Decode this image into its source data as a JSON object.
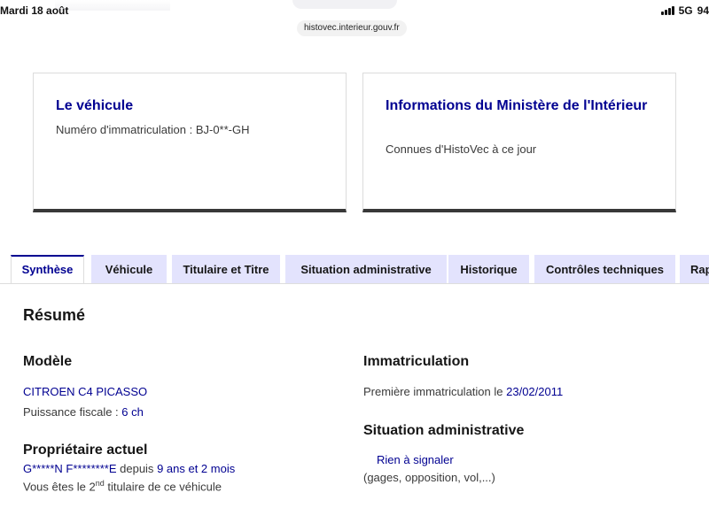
{
  "status_bar": {
    "date": "Mardi 18 août",
    "network": "5G",
    "battery": "94"
  },
  "browser": {
    "url": "histovec.interieur.gouv.fr"
  },
  "cards": {
    "vehicle": {
      "title": "Le véhicule",
      "plate_label": "Numéro d'immatriculation :",
      "plate": "BJ-0**-GH"
    },
    "ministry": {
      "title": "Informations du Ministère de l'Intérieur",
      "subtitle": "Connues d'HistoVec à ce jour"
    }
  },
  "tabs": [
    {
      "label": "Synthèse",
      "active": true
    },
    {
      "label": "Véhicule",
      "active": false
    },
    {
      "label": "Titulaire et Titre",
      "active": false
    },
    {
      "label": "Situation administrative",
      "active": false
    },
    {
      "label": "Historique",
      "active": false
    },
    {
      "label": "Contrôles techniques",
      "active": false
    },
    {
      "label": "Rapport",
      "active": false
    }
  ],
  "summary": {
    "heading": "Résumé",
    "model": {
      "heading": "Modèle",
      "name": "CITROEN C4 PICASSO",
      "power_label": "Puissance fiscale :",
      "power_value": "6 ch"
    },
    "owner": {
      "heading": "Propriétaire actuel",
      "name": "G*****N F********E",
      "since_label": "depuis",
      "duration": "9 ans et 2 mois",
      "rank_prefix": "Vous êtes le",
      "rank_num": "2",
      "rank_sup": "nd",
      "rank_suffix": "titulaire de ce véhicule"
    },
    "registration": {
      "heading": "Immatriculation",
      "first_label": "Première immatriculation le",
      "first_date": "23/02/2011"
    },
    "admin": {
      "heading": "Situation administrative",
      "status": "Rien à signaler",
      "details": "(gages, opposition, vol,...)"
    }
  }
}
